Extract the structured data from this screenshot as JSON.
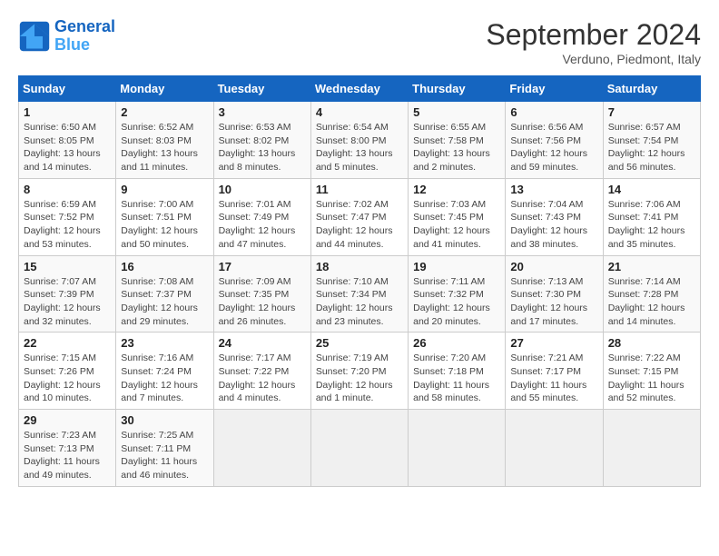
{
  "header": {
    "logo_line1": "General",
    "logo_line2": "Blue",
    "month_title": "September 2024",
    "subtitle": "Verduno, Piedmont, Italy"
  },
  "columns": [
    "Sunday",
    "Monday",
    "Tuesday",
    "Wednesday",
    "Thursday",
    "Friday",
    "Saturday"
  ],
  "weeks": [
    [
      {
        "day": "1",
        "info": "Sunrise: 6:50 AM\nSunset: 8:05 PM\nDaylight: 13 hours and 14 minutes."
      },
      {
        "day": "2",
        "info": "Sunrise: 6:52 AM\nSunset: 8:03 PM\nDaylight: 13 hours and 11 minutes."
      },
      {
        "day": "3",
        "info": "Sunrise: 6:53 AM\nSunset: 8:02 PM\nDaylight: 13 hours and 8 minutes."
      },
      {
        "day": "4",
        "info": "Sunrise: 6:54 AM\nSunset: 8:00 PM\nDaylight: 13 hours and 5 minutes."
      },
      {
        "day": "5",
        "info": "Sunrise: 6:55 AM\nSunset: 7:58 PM\nDaylight: 13 hours and 2 minutes."
      },
      {
        "day": "6",
        "info": "Sunrise: 6:56 AM\nSunset: 7:56 PM\nDaylight: 12 hours and 59 minutes."
      },
      {
        "day": "7",
        "info": "Sunrise: 6:57 AM\nSunset: 7:54 PM\nDaylight: 12 hours and 56 minutes."
      }
    ],
    [
      {
        "day": "8",
        "info": "Sunrise: 6:59 AM\nSunset: 7:52 PM\nDaylight: 12 hours and 53 minutes."
      },
      {
        "day": "9",
        "info": "Sunrise: 7:00 AM\nSunset: 7:51 PM\nDaylight: 12 hours and 50 minutes."
      },
      {
        "day": "10",
        "info": "Sunrise: 7:01 AM\nSunset: 7:49 PM\nDaylight: 12 hours and 47 minutes."
      },
      {
        "day": "11",
        "info": "Sunrise: 7:02 AM\nSunset: 7:47 PM\nDaylight: 12 hours and 44 minutes."
      },
      {
        "day": "12",
        "info": "Sunrise: 7:03 AM\nSunset: 7:45 PM\nDaylight: 12 hours and 41 minutes."
      },
      {
        "day": "13",
        "info": "Sunrise: 7:04 AM\nSunset: 7:43 PM\nDaylight: 12 hours and 38 minutes."
      },
      {
        "day": "14",
        "info": "Sunrise: 7:06 AM\nSunset: 7:41 PM\nDaylight: 12 hours and 35 minutes."
      }
    ],
    [
      {
        "day": "15",
        "info": "Sunrise: 7:07 AM\nSunset: 7:39 PM\nDaylight: 12 hours and 32 minutes."
      },
      {
        "day": "16",
        "info": "Sunrise: 7:08 AM\nSunset: 7:37 PM\nDaylight: 12 hours and 29 minutes."
      },
      {
        "day": "17",
        "info": "Sunrise: 7:09 AM\nSunset: 7:35 PM\nDaylight: 12 hours and 26 minutes."
      },
      {
        "day": "18",
        "info": "Sunrise: 7:10 AM\nSunset: 7:34 PM\nDaylight: 12 hours and 23 minutes."
      },
      {
        "day": "19",
        "info": "Sunrise: 7:11 AM\nSunset: 7:32 PM\nDaylight: 12 hours and 20 minutes."
      },
      {
        "day": "20",
        "info": "Sunrise: 7:13 AM\nSunset: 7:30 PM\nDaylight: 12 hours and 17 minutes."
      },
      {
        "day": "21",
        "info": "Sunrise: 7:14 AM\nSunset: 7:28 PM\nDaylight: 12 hours and 14 minutes."
      }
    ],
    [
      {
        "day": "22",
        "info": "Sunrise: 7:15 AM\nSunset: 7:26 PM\nDaylight: 12 hours and 10 minutes."
      },
      {
        "day": "23",
        "info": "Sunrise: 7:16 AM\nSunset: 7:24 PM\nDaylight: 12 hours and 7 minutes."
      },
      {
        "day": "24",
        "info": "Sunrise: 7:17 AM\nSunset: 7:22 PM\nDaylight: 12 hours and 4 minutes."
      },
      {
        "day": "25",
        "info": "Sunrise: 7:19 AM\nSunset: 7:20 PM\nDaylight: 12 hours and 1 minute."
      },
      {
        "day": "26",
        "info": "Sunrise: 7:20 AM\nSunset: 7:18 PM\nDaylight: 11 hours and 58 minutes."
      },
      {
        "day": "27",
        "info": "Sunrise: 7:21 AM\nSunset: 7:17 PM\nDaylight: 11 hours and 55 minutes."
      },
      {
        "day": "28",
        "info": "Sunrise: 7:22 AM\nSunset: 7:15 PM\nDaylight: 11 hours and 52 minutes."
      }
    ],
    [
      {
        "day": "29",
        "info": "Sunrise: 7:23 AM\nSunset: 7:13 PM\nDaylight: 11 hours and 49 minutes."
      },
      {
        "day": "30",
        "info": "Sunrise: 7:25 AM\nSunset: 7:11 PM\nDaylight: 11 hours and 46 minutes."
      },
      {
        "day": "",
        "info": ""
      },
      {
        "day": "",
        "info": ""
      },
      {
        "day": "",
        "info": ""
      },
      {
        "day": "",
        "info": ""
      },
      {
        "day": "",
        "info": ""
      }
    ]
  ]
}
